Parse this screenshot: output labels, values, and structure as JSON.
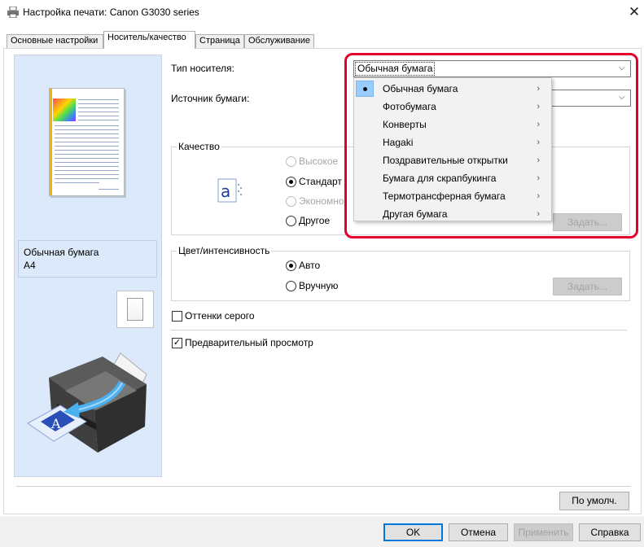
{
  "window": {
    "title": "Настройка печати: Canon G3030 series",
    "close_glyph": "✕"
  },
  "tabs": [
    {
      "label": "Основные настройки"
    },
    {
      "label": "Носитель/качество"
    },
    {
      "label": "Страница"
    },
    {
      "label": "Обслуживание"
    }
  ],
  "preview": {
    "media_name": "Обычная бумага",
    "paper_size": "A4"
  },
  "media_type": {
    "label": "Тип носителя:",
    "selected": "Обычная бумага",
    "options": [
      {
        "label": "Обычная бумага",
        "checked": true
      },
      {
        "label": "Фотобумага"
      },
      {
        "label": "Конверты"
      },
      {
        "label": "Hagaki"
      },
      {
        "label": "Поздравительные открытки"
      },
      {
        "label": "Бумага для скрапбукинга"
      },
      {
        "label": "Термотрансферная бумага"
      },
      {
        "label": "Другая бумага"
      }
    ]
  },
  "paper_source": {
    "label": "Источник бумаги:"
  },
  "quality": {
    "title": "Качество",
    "options": [
      {
        "label": "Высокое",
        "enabled": false,
        "checked": false
      },
      {
        "label": "Стандарт",
        "enabled": true,
        "checked": true
      },
      {
        "label": "Экономно",
        "enabled": false,
        "checked": false
      },
      {
        "label": "Другое",
        "enabled": true,
        "checked": false
      }
    ],
    "set_button": "Задать..."
  },
  "color": {
    "title": "Цвет/интенсивность",
    "options": [
      {
        "label": "Авто",
        "checked": true
      },
      {
        "label": "Вручную",
        "checked": false
      }
    ],
    "set_button": "Задать..."
  },
  "grayscale": {
    "label": "Оттенки серого",
    "checked": false
  },
  "preview_before_print": {
    "label": "Предварительный просмотр",
    "checked": true
  },
  "defaults_button": "По умолч.",
  "footer": {
    "ok": "OK",
    "cancel": "Отмена",
    "apply": "Применить",
    "help": "Справка"
  },
  "icons": {
    "dropdown_arrow": "⌵",
    "submenu_arrow": "›",
    "check": "✓"
  },
  "colors": {
    "highlight_ring": "#e4002b",
    "selection": "#cce8ff",
    "preview_panel": "#dbe9fb"
  }
}
